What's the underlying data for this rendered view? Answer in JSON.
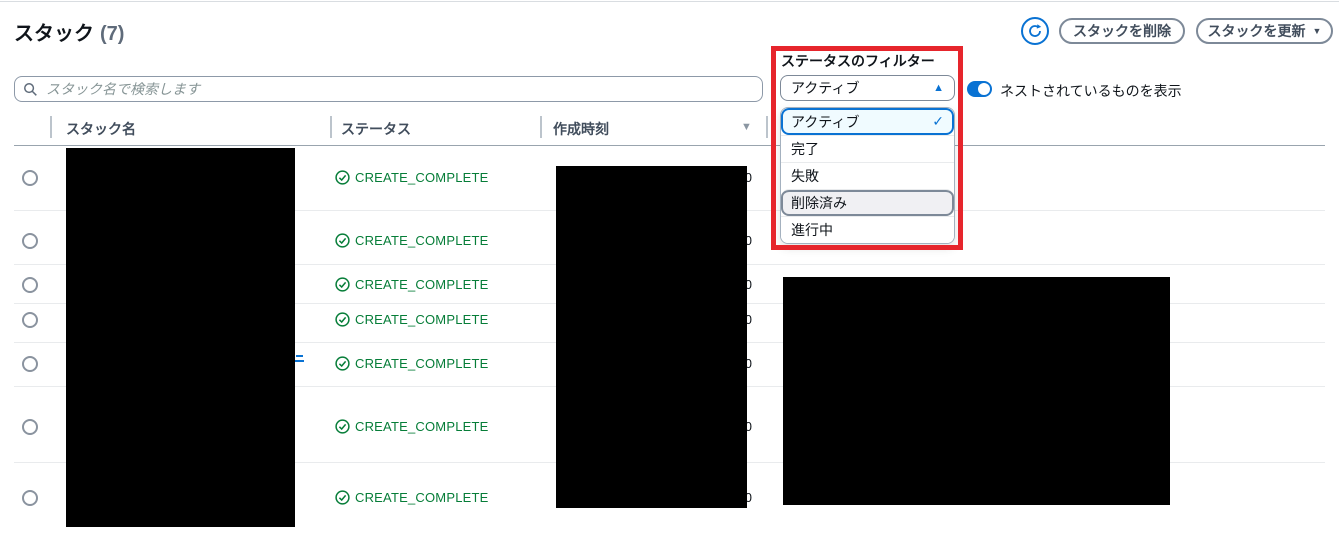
{
  "page": {
    "title": "スタック",
    "count": "(7)"
  },
  "toolbar": {
    "delete_label": "スタックを削除",
    "update_label": "スタックを更新"
  },
  "search": {
    "placeholder": "スタック名で検索します",
    "value": ""
  },
  "filter": {
    "label": "ステータスのフィルター",
    "selected": "アクティブ",
    "options": [
      {
        "label": "アクティブ"
      },
      {
        "label": "完了"
      },
      {
        "label": "失敗"
      },
      {
        "label": "削除済み"
      },
      {
        "label": "進行中"
      }
    ]
  },
  "toggle": {
    "label": "ネストされているものを表示",
    "state": "on"
  },
  "table": {
    "columns": [
      "スタック名",
      "ステータス",
      "作成時刻"
    ],
    "rows": [
      {
        "status": "CREATE_COMPLETE",
        "time_fragment": "0"
      },
      {
        "status": "CREATE_COMPLETE",
        "time_fragment": "0"
      },
      {
        "status": "CREATE_COMPLETE",
        "time_fragment": "0"
      },
      {
        "status": "CREATE_COMPLETE",
        "time_fragment": "0"
      },
      {
        "status": "CREATE_COMPLETE",
        "time_fragment": "0"
      },
      {
        "status": "CREATE_COMPLETE",
        "time_fragment": "0"
      },
      {
        "status": "CREATE_COMPLETE",
        "time_fragment": "0"
      }
    ]
  },
  "icons": {
    "caret_down": "▼",
    "caret_up": "▲",
    "check": "✓"
  },
  "colors": {
    "accent_blue": "#0972d3",
    "success_green": "#067d38",
    "annotation_red": "#e6252c"
  }
}
